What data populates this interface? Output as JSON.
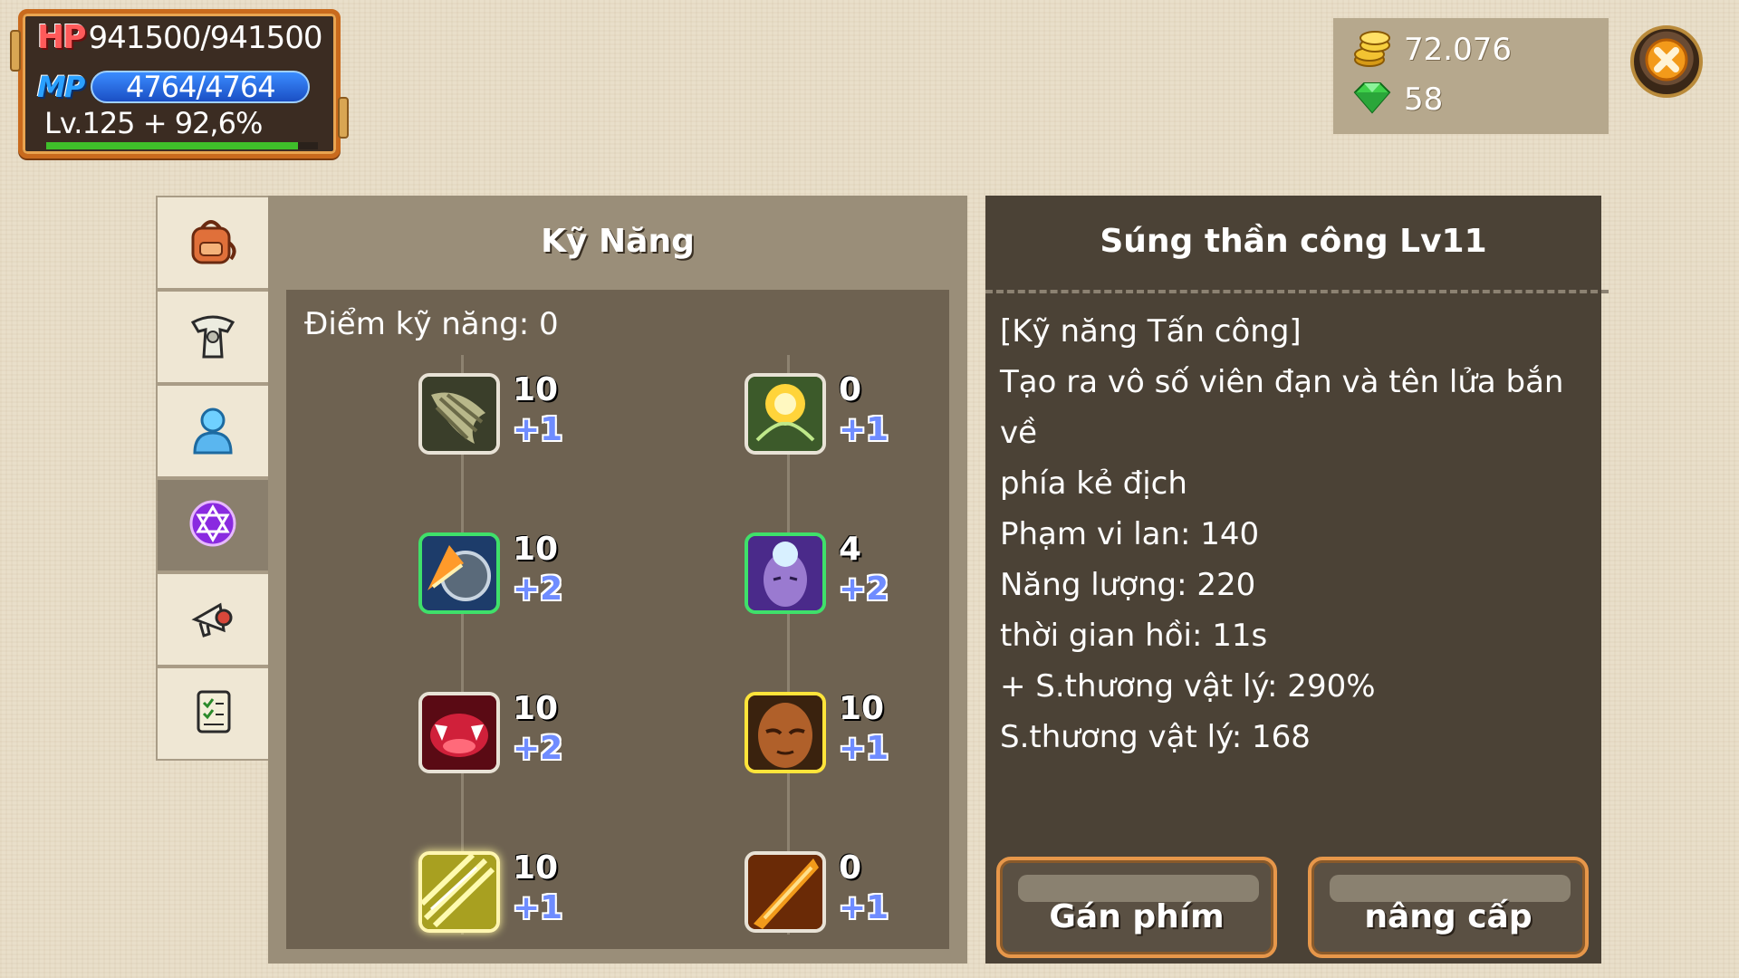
{
  "status": {
    "hp_tag": "HP",
    "hp_value": "941500/941500",
    "mp_tag": "MP",
    "mp_value": "4764/4764",
    "level_text": "Lv.125 + 92,6%",
    "exp_progress": 0.926
  },
  "currency": {
    "gold_icon": "gold-coins-icon",
    "gold": "72.076",
    "gem_icon": "green-gem-icon",
    "gems": "58"
  },
  "close": {
    "icon": "close-icon"
  },
  "tabs": [
    {
      "icon": "backpack-icon",
      "active": false
    },
    {
      "icon": "armor-icon",
      "active": false
    },
    {
      "icon": "character-icon",
      "active": false
    },
    {
      "icon": "hexagram-icon",
      "active": true
    },
    {
      "icon": "horn-icon",
      "active": false
    },
    {
      "icon": "quest-scroll-icon",
      "active": false
    }
  ],
  "skills_panel": {
    "title": "Kỹ Năng",
    "points_label": "Điểm kỹ năng: 0",
    "skills": [
      {
        "icon": "drill-icon",
        "level": "10",
        "add": "+1"
      },
      {
        "icon": "sun-burst-icon",
        "level": "0",
        "add": "+1"
      },
      {
        "icon": "spinning-blade-icon",
        "level": "10",
        "add": "+2"
      },
      {
        "icon": "glowing-face-icon",
        "level": "4",
        "add": "+2"
      },
      {
        "icon": "fangs-icon",
        "level": "10",
        "add": "+2"
      },
      {
        "icon": "focused-face-icon",
        "level": "10",
        "add": "+1"
      },
      {
        "icon": "lightning-strike-icon",
        "level": "10",
        "add": "+1"
      },
      {
        "icon": "fire-slash-icon",
        "level": "0",
        "add": "+1"
      }
    ]
  },
  "detail": {
    "title": "Súng thần công Lv11",
    "lines": [
      "[Kỹ năng Tấn công]",
      "Tạo ra vô số viên đạn và tên lửa bắn về",
      "phía kẻ địch",
      "Phạm vi lan: 140",
      "Năng lượng: 220",
      "thời gian hồi: 11s",
      "+ S.thương vật lý: 290%",
      "S.thương vật lý: 168"
    ],
    "assign_label": "Gán phím",
    "upgrade_label": "nâng cấp"
  }
}
